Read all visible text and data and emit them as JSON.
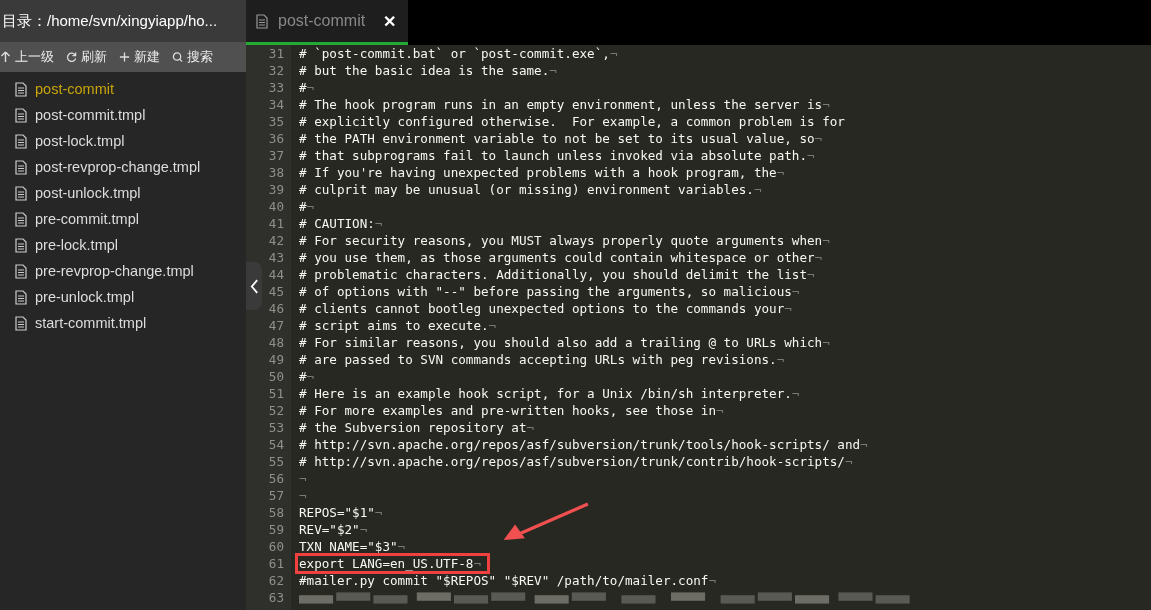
{
  "sidebar": {
    "title": "目录：/home/svn/xingyiapp/ho...",
    "toolbar": [
      {
        "kind": "up",
        "label": "上一级"
      },
      {
        "kind": "refresh",
        "label": "刷新"
      },
      {
        "kind": "new",
        "label": "新建"
      },
      {
        "kind": "search",
        "label": "搜索"
      }
    ],
    "files": [
      {
        "name": "post-commit",
        "selected": true
      },
      {
        "name": "post-commit.tmpl",
        "selected": false
      },
      {
        "name": "post-lock.tmpl",
        "selected": false
      },
      {
        "name": "post-revprop-change.tmpl",
        "selected": false
      },
      {
        "name": "post-unlock.tmpl",
        "selected": false
      },
      {
        "name": "pre-commit.tmpl",
        "selected": false
      },
      {
        "name": "pre-lock.tmpl",
        "selected": false
      },
      {
        "name": "pre-revprop-change.tmpl",
        "selected": false
      },
      {
        "name": "pre-unlock.tmpl",
        "selected": false
      },
      {
        "name": "start-commit.tmpl",
        "selected": false
      }
    ]
  },
  "editor": {
    "tabs": [
      {
        "label": "post-commit",
        "selected": true,
        "close": "✕"
      }
    ],
    "lines": [
      {
        "number": "31",
        "text": "# `post-commit.bat` or `post-commit.exe`,",
        "eol": "¬"
      },
      {
        "number": "32",
        "text": "# but the basic idea is the same.",
        "eol": "¬"
      },
      {
        "number": "33",
        "text": "#",
        "eol": "¬"
      },
      {
        "number": "34",
        "text": "# The hook program runs in an empty environment, unless the server is",
        "eol": "¬"
      },
      {
        "number": "35",
        "text": "# explicitly configured otherwise.  For example, a common problem is for"
      },
      {
        "number": "36",
        "text": "# the PATH environment variable to not be set to its usual value, so",
        "eol": "¬"
      },
      {
        "number": "37",
        "text": "# that subprograms fail to launch unless invoked via absolute path.",
        "eol": "¬"
      },
      {
        "number": "38",
        "text": "# If you're having unexpected problems with a hook program, the",
        "eol": "¬"
      },
      {
        "number": "39",
        "text": "# culprit may be unusual (or missing) environment variables.",
        "eol": "¬"
      },
      {
        "number": "40",
        "text": "#",
        "eol": "¬"
      },
      {
        "number": "41",
        "text": "# CAUTION:",
        "eol": "¬"
      },
      {
        "number": "42",
        "text": "# For security reasons, you MUST always properly quote arguments when",
        "eol": "¬"
      },
      {
        "number": "43",
        "text": "# you use them, as those arguments could contain whitespace or other",
        "eol": "¬"
      },
      {
        "number": "44",
        "text": "# problematic characters. Additionally, you should delimit the list",
        "eol": "¬"
      },
      {
        "number": "45",
        "text": "# of options with \"--\" before passing the arguments, so malicious",
        "eol": "¬"
      },
      {
        "number": "46",
        "text": "# clients cannot bootleg unexpected options to the commands your",
        "eol": "¬"
      },
      {
        "number": "47",
        "text": "# script aims to execute.",
        "eol": "¬"
      },
      {
        "number": "48",
        "text": "# For similar reasons, you should also add a trailing @ to URLs which",
        "eol": "¬"
      },
      {
        "number": "49",
        "text": "# are passed to SVN commands accepting URLs with peg revisions.",
        "eol": "¬"
      },
      {
        "number": "50",
        "text": "#",
        "eol": "¬"
      },
      {
        "number": "51",
        "text": "# Here is an example hook script, for a Unix /bin/sh interpreter.",
        "eol": "¬"
      },
      {
        "number": "52",
        "text": "# For more examples and pre-written hooks, see those in",
        "eol": "¬"
      },
      {
        "number": "53",
        "text": "# the Subversion repository at",
        "eol": "¬"
      },
      {
        "number": "54",
        "text": "# http://svn.apache.org/repos/asf/subversion/trunk/tools/hook-scripts/ and",
        "eol": "¬"
      },
      {
        "number": "55",
        "text": "# http://svn.apache.org/repos/asf/subversion/trunk/contrib/hook-scripts/",
        "eol": "¬"
      },
      {
        "number": "56",
        "eol": "¬"
      },
      {
        "number": "57",
        "eol": "¬"
      },
      {
        "number": "58",
        "text": "REPOS=\"$1\"",
        "eol": "¬"
      },
      {
        "number": "59",
        "text": "REV=\"$2\"",
        "eol": "¬"
      },
      {
        "number": "60",
        "text": "TXN_NAME=\"$3\"",
        "eol": "¬"
      },
      {
        "number": "61",
        "text": "export LANG=en_US.UTF-8",
        "eol": "¬",
        "highlighted": true
      },
      {
        "number": "62",
        "text": "#mailer.py commit \"$REPOS\" \"$REV\" /path/to/mailer.conf",
        "eol": "¬"
      },
      {
        "number": "63",
        "blurred": true
      }
    ]
  }
}
